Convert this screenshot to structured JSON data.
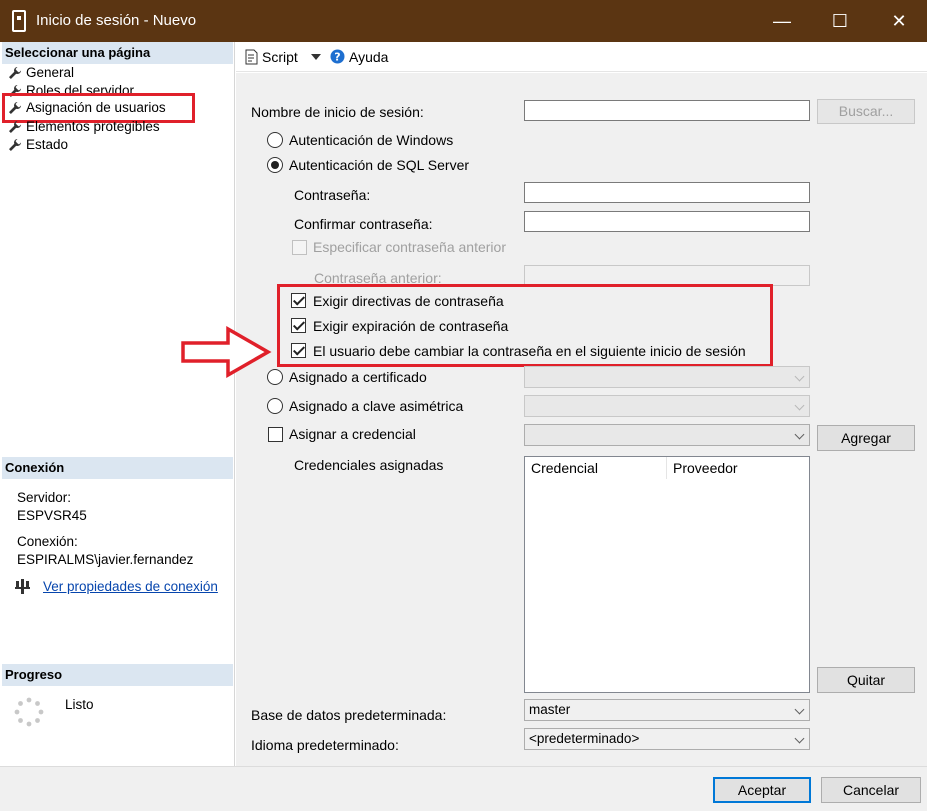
{
  "window": {
    "title": "Inicio de sesión - Nuevo",
    "minimize_glyph": "—",
    "maximize_glyph": "☐",
    "close_glyph": "✕"
  },
  "left": {
    "select_page_header": "Seleccionar una página",
    "pages": [
      {
        "label": "General",
        "icon": "wrench-icon"
      },
      {
        "label": "Roles del servidor",
        "icon": "wrench-icon"
      },
      {
        "label": "Asignación de usuarios",
        "icon": "wrench-icon"
      },
      {
        "label": "Elementos protegibles",
        "icon": "wrench-icon"
      },
      {
        "label": "Estado",
        "icon": "wrench-icon"
      }
    ],
    "connection_header": "Conexión",
    "server_label": "Servidor:",
    "server_value": "ESPVSR45",
    "connection_label": "Conexión:",
    "connection_value": "ESPIRALMS\\javier.fernandez",
    "view_props_link": "Ver propiedades de conexión",
    "progress_header": "Progreso",
    "progress_status": "Listo"
  },
  "toolbar": {
    "script_label": "Script",
    "help_label": "Ayuda"
  },
  "form": {
    "login_name_label": "Nombre de inicio de sesión:",
    "login_name_value": "",
    "search_button": "Buscar...",
    "windows_auth_label": "Autenticación de Windows",
    "sql_auth_label": "Autenticación de SQL Server",
    "password_label": "Contraseña:",
    "confirm_password_label": "Confirmar contraseña:",
    "specify_old_password_label": "Especificar contraseña anterior",
    "old_password_label": "Contraseña anterior:",
    "enforce_policy_label": "Exigir directivas de contraseña",
    "enforce_expiration_label": "Exigir expiración de contraseña",
    "must_change_label": "El usuario debe cambiar la contraseña en el siguiente inicio de sesión",
    "cert_label": "Asignado a certificado",
    "asym_key_label": "Asignado a clave asimétrica",
    "map_credential_label": "Asignar a credencial",
    "add_button": "Agregar",
    "mapped_credentials_label": "Credenciales asignadas",
    "col_credential": "Credencial",
    "col_provider": "Proveedor",
    "remove_button": "Quitar",
    "default_db_label": "Base de datos predeterminada:",
    "default_db_value": "master",
    "default_lang_label": "Idioma predeterminado:",
    "default_lang_value": "<predeterminado>"
  },
  "footer": {
    "ok_button": "Aceptar",
    "cancel_button": "Cancelar"
  },
  "colors": {
    "titlebar": "#5b3512",
    "highlight_red": "#e0202a",
    "section_header": "#dbe6f1",
    "link": "#0645ad"
  }
}
